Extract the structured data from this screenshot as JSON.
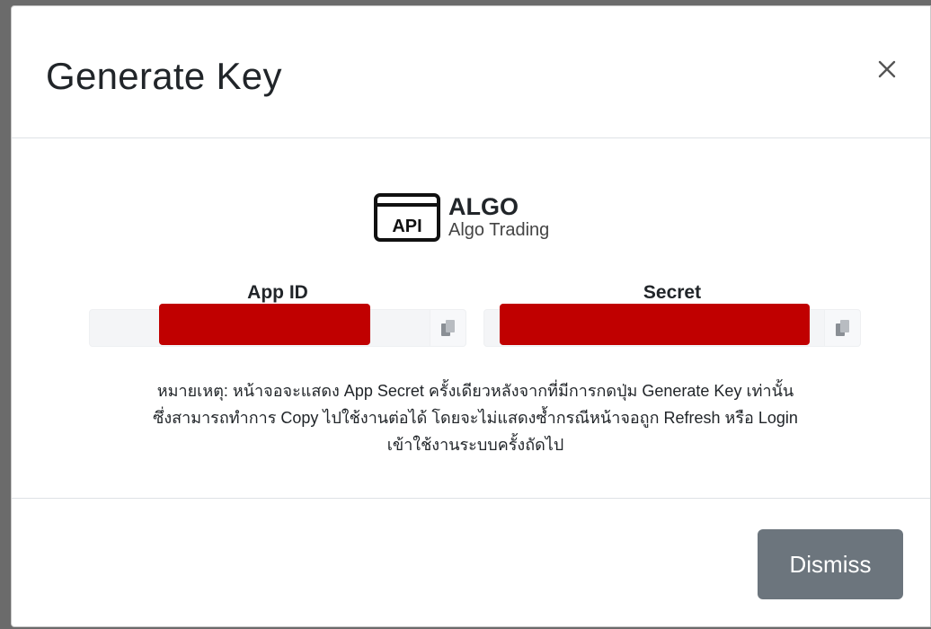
{
  "modal": {
    "title": "Generate Key",
    "close_label": "×"
  },
  "app": {
    "icon": "api-icon",
    "icon_text": "API",
    "name": "ALGO",
    "subtitle": "Algo Trading"
  },
  "fields": {
    "app_id": {
      "label": "App ID",
      "value": "",
      "copy_icon": "copy-icon",
      "redacted": true
    },
    "secret": {
      "label": "Secret",
      "value": "",
      "copy_icon": "copy-icon",
      "redacted": true
    }
  },
  "note": {
    "line1": "หมายเหตุ: หน้าจอจะแสดง App Secret ครั้งเดียวหลังจากที่มีการกดปุ่ม Generate Key เท่านั้น",
    "line2": "ซึ่งสามารถทำการ Copy ไปใช้งานต่อได้ โดยจะไม่แสดงซ้ำกรณีหน้าจอถูก Refresh หรือ Login",
    "line3": "เข้าใช้งานระบบครั้งถัดไป"
  },
  "footer": {
    "dismiss_label": "Dismiss"
  },
  "colors": {
    "redaction": "#c00000",
    "dismiss_button": "#6c757d"
  }
}
